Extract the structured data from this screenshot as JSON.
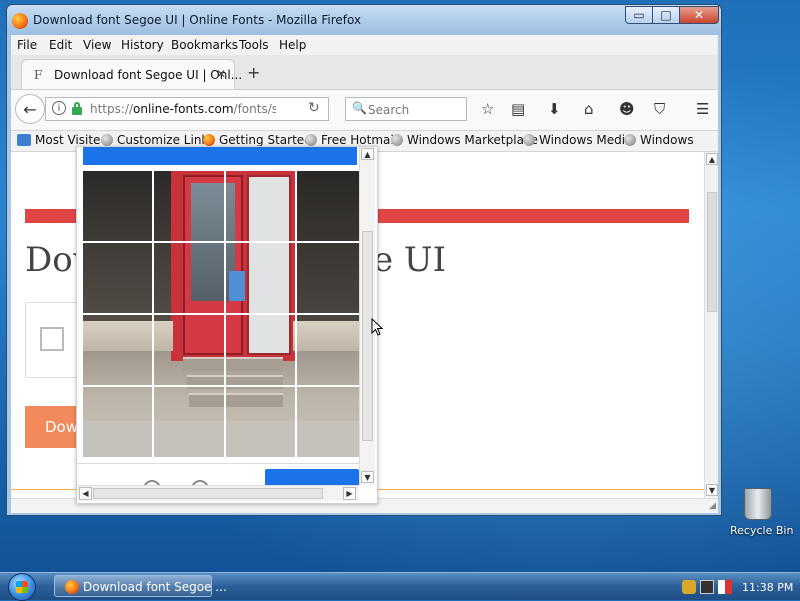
{
  "window": {
    "title": "Download font Segoe UI | Online Fonts - Mozilla Firefox",
    "controls": {
      "minimize": "▭",
      "maximize": "□",
      "close": "✕"
    }
  },
  "menubar": {
    "items": [
      "File",
      "Edit",
      "View",
      "History",
      "Bookmarks",
      "Tools",
      "Help"
    ]
  },
  "tabs": [
    {
      "favicon": "F",
      "title": "Download font Segoe UI | Onl...",
      "close": "✕"
    }
  ],
  "new_tab": "+",
  "navbar": {
    "url_prefix": "https://",
    "url_host": "online-fonts.com",
    "url_path": "/fonts/segoe",
    "search_placeholder": "Search",
    "icons": [
      "bookmark-star-icon",
      "library-icon",
      "download-icon",
      "home-icon",
      "smiley-icon",
      "pocket-icon",
      "hamburger-menu-icon"
    ]
  },
  "bookmarks": [
    {
      "label": "Most Visited",
      "icon": "most-visited-icon"
    },
    {
      "label": "Customize Links",
      "icon": "globe-icon"
    },
    {
      "label": "Getting Started",
      "icon": "firefox-icon"
    },
    {
      "label": "Free Hotmail",
      "icon": "globe-icon"
    },
    {
      "label": "Windows Marketplace",
      "icon": "globe-icon"
    },
    {
      "label": "Windows Media",
      "icon": "globe-icon"
    },
    {
      "label": "Windows",
      "icon": "globe-icon"
    }
  ],
  "page": {
    "heading": "Download font Segoe UI",
    "download_button": "Download",
    "accent_color": "#e04545",
    "button_color": "#f28a5c"
  },
  "captcha": {
    "grid": "4x4",
    "header_color": "#1a73e8",
    "image_subject": "red door storefront with steps"
  },
  "desktop": {
    "recycle_bin": "Recycle Bin"
  },
  "taskbar": {
    "task_label": "Download font Segoe ...",
    "clock": "11:38 PM"
  }
}
